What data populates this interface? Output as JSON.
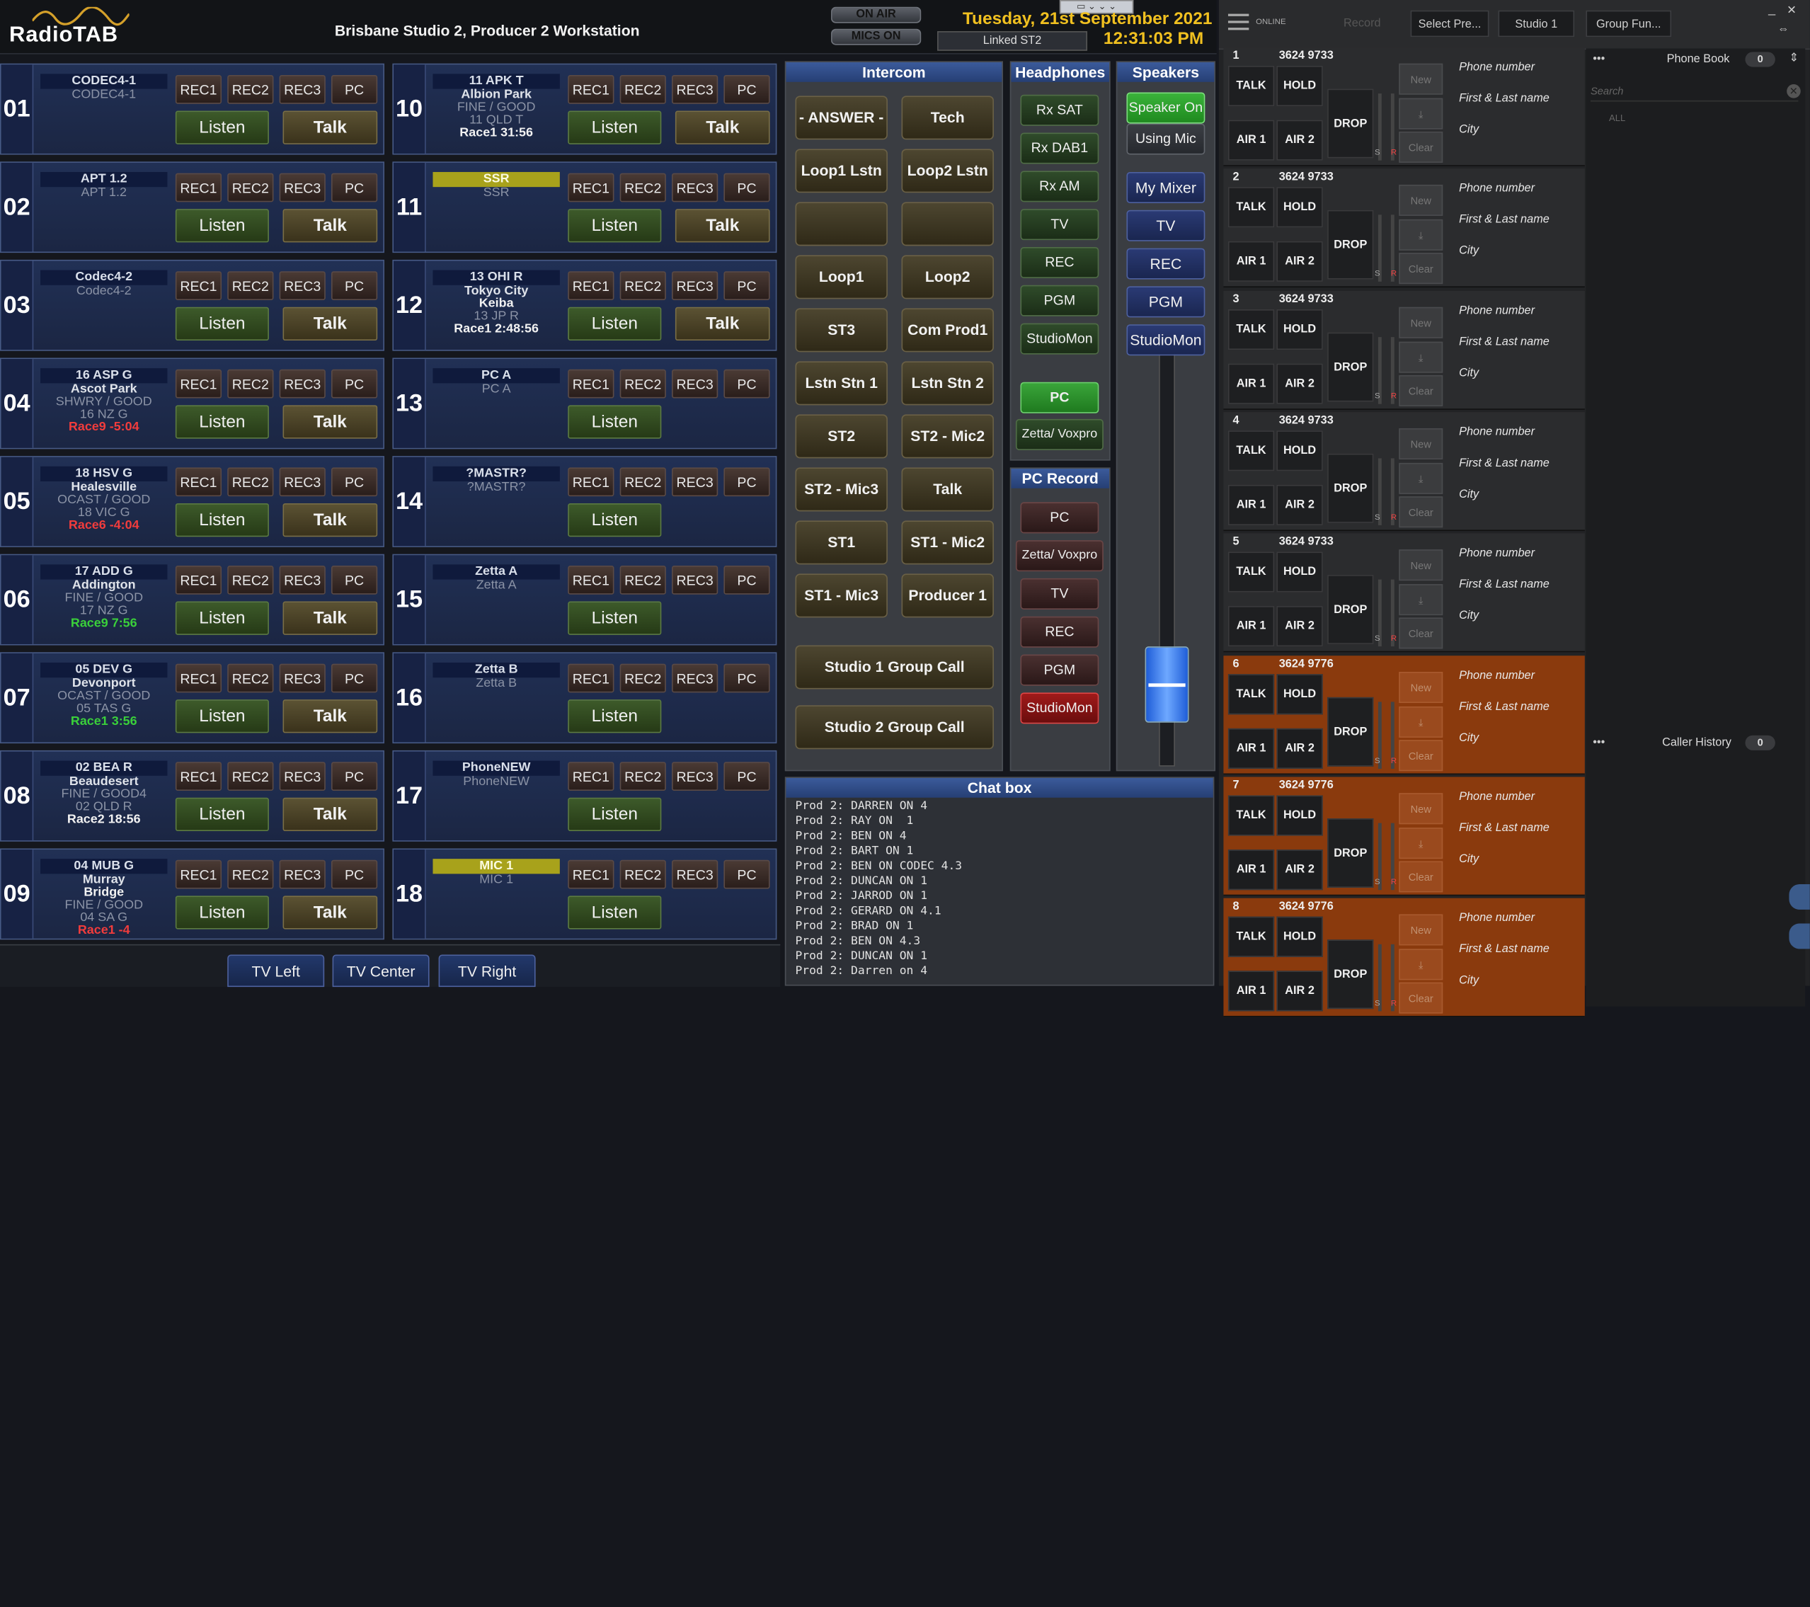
{
  "header": {
    "logo_text": "RadioTAB",
    "studio_title": "Brisbane Studio 2, Producer 2 Workstation",
    "on_air_label": "ON AIR",
    "mics_on_label": "MICS ON",
    "date": "Tuesday, 21st September 2021",
    "time": "12:31:03 PM",
    "linked_label": "Linked ST2",
    "accent_color": "#f0c020"
  },
  "channel_buttons": {
    "rec1": "REC1",
    "rec2": "REC2",
    "rec3": "REC3",
    "pc": "PC",
    "listen": "Listen",
    "talk": "Talk"
  },
  "channels": [
    {
      "num": "01",
      "name": "CODEC4-1",
      "lines": [
        {
          "text": "CODEC4-1",
          "style": "dim"
        }
      ],
      "talk": true
    },
    {
      "num": "02",
      "name": "APT 1.2",
      "lines": [
        {
          "text": "APT 1.2",
          "style": "dim"
        }
      ],
      "talk": true
    },
    {
      "num": "03",
      "name": "Codec4-2",
      "lines": [
        {
          "text": "Codec4-2",
          "style": "dim"
        }
      ],
      "talk": true
    },
    {
      "num": "04",
      "name": "16 ASP G",
      "lines": [
        {
          "text": "Ascot Park",
          "style": "bright"
        },
        {
          "text": "",
          "style": "dim"
        },
        {
          "text": "SHWRY / GOOD",
          "style": "dim"
        },
        {
          "text": "16 NZ G",
          "style": "dim"
        },
        {
          "text": "Race9 -5:04",
          "style": "red"
        }
      ],
      "talk": true
    },
    {
      "num": "05",
      "name": "18 HSV G",
      "lines": [
        {
          "text": "Healesville",
          "style": "bright"
        },
        {
          "text": "",
          "style": "dim"
        },
        {
          "text": "OCAST / GOOD",
          "style": "dim"
        },
        {
          "text": "18 VIC G",
          "style": "dim"
        },
        {
          "text": "Race6 -4:04",
          "style": "red"
        }
      ],
      "talk": true
    },
    {
      "num": "06",
      "name": "17 ADD G",
      "lines": [
        {
          "text": "Addington",
          "style": "bright"
        },
        {
          "text": "",
          "style": "dim"
        },
        {
          "text": "FINE / GOOD",
          "style": "dim"
        },
        {
          "text": "17 NZ G",
          "style": "dim"
        },
        {
          "text": "Race9 7:56",
          "style": "green"
        }
      ],
      "talk": true
    },
    {
      "num": "07",
      "name": "05 DEV G",
      "lines": [
        {
          "text": "Devonport",
          "style": "bright"
        },
        {
          "text": "",
          "style": "dim"
        },
        {
          "text": "OCAST / GOOD",
          "style": "dim"
        },
        {
          "text": "05 TAS G",
          "style": "dim"
        },
        {
          "text": "Race1 3:56",
          "style": "green"
        }
      ],
      "talk": true
    },
    {
      "num": "08",
      "name": "02 BEA R",
      "lines": [
        {
          "text": "Beaudesert",
          "style": "bright"
        },
        {
          "text": "",
          "style": "dim"
        },
        {
          "text": "FINE / GOOD4",
          "style": "dim"
        },
        {
          "text": "02 QLD R",
          "style": "dim"
        },
        {
          "text": "Race2 18:56",
          "style": "white"
        }
      ],
      "talk": true
    },
    {
      "num": "09",
      "name": "04 MUB G",
      "lines": [
        {
          "text": "Murray",
          "style": "bright"
        },
        {
          "text": "Bridge",
          "style": "white"
        },
        {
          "text": "FINE / GOOD",
          "style": "dim"
        },
        {
          "text": "04 SA G",
          "style": "dim"
        },
        {
          "text": "Race1 -4",
          "style": "red"
        }
      ],
      "talk": true
    },
    {
      "num": "10",
      "name": "11 APK T",
      "lines": [
        {
          "text": "Albion Park",
          "style": "bright"
        },
        {
          "text": "",
          "style": "dim"
        },
        {
          "text": "FINE / GOOD",
          "style": "dim"
        },
        {
          "text": "11 QLD T",
          "style": "dim"
        },
        {
          "text": "Race1 31:56",
          "style": "white"
        }
      ],
      "talk": true
    },
    {
      "num": "11",
      "name": "SSR",
      "yellow": true,
      "lines": [
        {
          "text": "SSR",
          "style": "dim"
        }
      ],
      "talk": true
    },
    {
      "num": "12",
      "name": "13 OHI R",
      "lines": [
        {
          "text": "Tokyo City",
          "style": "bright"
        },
        {
          "text": "Keiba",
          "style": "white"
        },
        {
          "text": "13 JP R",
          "style": "dim"
        },
        {
          "text": "",
          "style": "dim"
        },
        {
          "text": "Race1 2:48:56",
          "style": "white"
        }
      ],
      "talk": true
    },
    {
      "num": "13",
      "name": "PC A",
      "lines": [
        {
          "text": "PC A",
          "style": "dim"
        }
      ],
      "talk": false
    },
    {
      "num": "14",
      "name": "?MASTR?",
      "lines": [
        {
          "text": "?MASTR?",
          "style": "dim"
        }
      ],
      "talk": false
    },
    {
      "num": "15",
      "name": "Zetta A",
      "lines": [
        {
          "text": "Zetta A",
          "style": "dim"
        }
      ],
      "talk": false
    },
    {
      "num": "16",
      "name": "Zetta B",
      "lines": [
        {
          "text": "Zetta B",
          "style": "dim"
        }
      ],
      "talk": false
    },
    {
      "num": "17",
      "name": "PhoneNEW",
      "lines": [
        {
          "text": "PhoneNEW",
          "style": "dim"
        }
      ],
      "talk": false
    },
    {
      "num": "18",
      "name": "MIC 1",
      "yellow": true,
      "lines": [
        {
          "text": "MIC 1",
          "style": "dim"
        }
      ],
      "talk": false
    }
  ],
  "tv_buttons": [
    "TV Left",
    "TV Center",
    "TV Right"
  ],
  "intercom": {
    "title": "Intercom",
    "buttons": [
      "- ANSWER -",
      "Tech",
      "Loop1 Lstn",
      "Loop2 Lstn",
      "",
      "",
      "Loop1",
      "Loop2",
      "ST3",
      "Com Prod1",
      "Lstn Stn 1",
      "Lstn Stn 2",
      "ST2",
      "ST2 - Mic2",
      "ST2 - Mic3",
      "Talk",
      "ST1",
      "ST1 - Mic2",
      "ST1 - Mic3",
      "Producer 1"
    ],
    "group_calls": [
      "Studio 1 Group Call",
      "Studio 2 Group Call"
    ]
  },
  "headphones": {
    "title": "Headphones",
    "buttons": [
      "Rx SAT",
      "Rx DAB1",
      "Rx AM",
      "TV",
      "REC",
      "PGM",
      "StudioMon"
    ],
    "pc_button": "PC",
    "zetta_button": "Zetta/ Voxpro"
  },
  "pc_record": {
    "title": "PC Record",
    "buttons": [
      "PC",
      "Zetta/ Voxpro",
      "TV",
      "REC",
      "PGM",
      "StudioMon"
    ]
  },
  "speakers": {
    "title": "Speakers",
    "speaker_on": "Speaker On",
    "using_mic": "Using Mic",
    "buttons": [
      "My Mixer",
      "TV",
      "REC",
      "PGM",
      "StudioMon"
    ]
  },
  "chat": {
    "title": "Chat box",
    "lines": [
      "Prod 2: DARREN ON 4",
      "Prod 2: RAY ON  1",
      "Prod 2: BEN ON 4",
      "Prod 2: BART ON 1",
      "Prod 2: BEN ON CODEC 4.3",
      "Prod 2: DUNCAN ON 1",
      "Prod 2: JARROD ON 1",
      "Prod 2: GERARD ON 4.1",
      "Prod 2: BRAD ON 1",
      "Prod 2: BEN ON 4.3",
      "Prod 2: DUNCAN ON 1",
      "Prod 2: Darren on 4"
    ]
  },
  "phone": {
    "status": "ONLINE",
    "record_label": "Record",
    "select_preset": "Select Pre...",
    "studio_button": "Studio 1",
    "group_function": "Group Fun...",
    "labels": {
      "talk": "TALK",
      "hold": "HOLD",
      "drop": "DROP",
      "air1": "AIR 1",
      "air2": "AIR 2",
      "new": "New",
      "clear": "Clear",
      "phone_field": "Phone number",
      "name_field": "First & Last name",
      "city_field": "City",
      "s": "S",
      "r": "R"
    },
    "lines": [
      {
        "num": "1",
        "phone": "3624 9733",
        "active": false
      },
      {
        "num": "2",
        "phone": "3624 9733",
        "active": false
      },
      {
        "num": "3",
        "phone": "3624 9733",
        "active": false
      },
      {
        "num": "4",
        "phone": "3624 9733",
        "active": false
      },
      {
        "num": "5",
        "phone": "3624 9733",
        "active": false
      },
      {
        "num": "6",
        "phone": "3624 9776",
        "active": true
      },
      {
        "num": "7",
        "phone": "3624 9776",
        "active": true
      },
      {
        "num": "8",
        "phone": "3624 9776",
        "active": true
      }
    ],
    "phone_book": {
      "title": "Phone Book",
      "count": "0",
      "search_placeholder": "Search",
      "filter": "ALL"
    },
    "caller_history": {
      "title": "Caller History",
      "count": "0"
    },
    "active_color": "#8a3a0d"
  }
}
